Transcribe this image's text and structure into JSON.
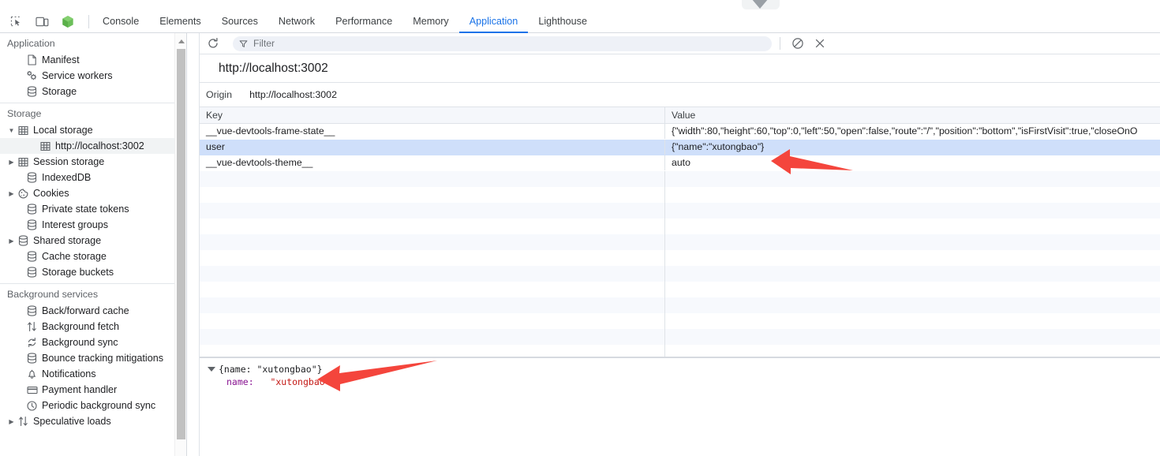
{
  "window": {
    "chevron_icon": "chevron-down-icon"
  },
  "toolbar": {
    "inspect_icon": "inspect-element-icon",
    "device_icon": "device-toolbar-icon",
    "vue_icon": "vue-logo-icon",
    "tabs": [
      {
        "label": "Console",
        "active": false
      },
      {
        "label": "Elements",
        "active": false
      },
      {
        "label": "Sources",
        "active": false
      },
      {
        "label": "Network",
        "active": false
      },
      {
        "label": "Performance",
        "active": false
      },
      {
        "label": "Memory",
        "active": false
      },
      {
        "label": "Application",
        "active": true
      },
      {
        "label": "Lighthouse",
        "active": false
      }
    ]
  },
  "sidebar": {
    "sections": [
      {
        "title": "Application",
        "items": [
          {
            "label": "Manifest",
            "icon": "manifest-file-icon",
            "indent": 2,
            "twisty": "",
            "selected": false
          },
          {
            "label": "Service workers",
            "icon": "service-workers-icon",
            "indent": 2,
            "twisty": "",
            "selected": false
          },
          {
            "label": "Storage",
            "icon": "database-icon",
            "indent": 2,
            "twisty": "",
            "selected": false
          }
        ]
      },
      {
        "title": "Storage",
        "items": [
          {
            "label": "Local storage",
            "icon": "table-grid-icon",
            "indent": 1,
            "twisty": "▼",
            "selected": false
          },
          {
            "label": "http://localhost:3002",
            "icon": "table-grid-icon",
            "indent": 3,
            "twisty": "",
            "selected": true
          },
          {
            "label": "Session storage",
            "icon": "table-grid-icon",
            "indent": 1,
            "twisty": "▶",
            "selected": false
          },
          {
            "label": "IndexedDB",
            "icon": "database-icon",
            "indent": 2,
            "twisty": "",
            "selected": false
          },
          {
            "label": "Cookies",
            "icon": "cookie-icon",
            "indent": 1,
            "twisty": "▶",
            "selected": false
          },
          {
            "label": "Private state tokens",
            "icon": "database-icon",
            "indent": 2,
            "twisty": "",
            "selected": false
          },
          {
            "label": "Interest groups",
            "icon": "database-icon",
            "indent": 2,
            "twisty": "",
            "selected": false
          },
          {
            "label": "Shared storage",
            "icon": "database-icon",
            "indent": 1,
            "twisty": "▶",
            "selected": false
          },
          {
            "label": "Cache storage",
            "icon": "database-icon",
            "indent": 2,
            "twisty": "",
            "selected": false
          },
          {
            "label": "Storage buckets",
            "icon": "database-icon",
            "indent": 2,
            "twisty": "",
            "selected": false
          }
        ]
      },
      {
        "title": "Background services",
        "items": [
          {
            "label": "Back/forward cache",
            "icon": "database-icon",
            "indent": 2,
            "twisty": "",
            "selected": false
          },
          {
            "label": "Background fetch",
            "icon": "updown-arrows-icon",
            "indent": 2,
            "twisty": "",
            "selected": false
          },
          {
            "label": "Background sync",
            "icon": "sync-icon",
            "indent": 2,
            "twisty": "",
            "selected": false
          },
          {
            "label": "Bounce tracking mitigations",
            "icon": "database-icon",
            "indent": 2,
            "twisty": "",
            "selected": false
          },
          {
            "label": "Notifications",
            "icon": "bell-icon",
            "indent": 2,
            "twisty": "",
            "selected": false
          },
          {
            "label": "Payment handler",
            "icon": "credit-card-icon",
            "indent": 2,
            "twisty": "",
            "selected": false
          },
          {
            "label": "Periodic background sync",
            "icon": "clock-icon",
            "indent": 2,
            "twisty": "",
            "selected": false
          },
          {
            "label": "Speculative loads",
            "icon": "updown-arrows-icon",
            "indent": 1,
            "twisty": "▶",
            "selected": false
          }
        ]
      }
    ]
  },
  "storage_toolbar": {
    "refresh_icon": "refresh-icon",
    "filter_icon": "filter-funnel-icon",
    "filter_placeholder": "Filter",
    "filter_value": "",
    "clear_icon": "clear-all-icon",
    "delete_icon": "delete-x-icon"
  },
  "panel": {
    "url_title": "http://localhost:3002",
    "origin_label": "Origin",
    "origin_value": "http://localhost:3002"
  },
  "table": {
    "columns": [
      "Key",
      "Value"
    ],
    "rows": [
      {
        "key": "__vue-devtools-frame-state__",
        "value": "{\"width\":80,\"height\":60,\"top\":0,\"left\":50,\"open\":false,\"route\":\"/\",\"position\":\"bottom\",\"isFirstVisit\":true,\"closeOnO",
        "selected": false
      },
      {
        "key": "user",
        "value": "{\"name\":\"xutongbao\"}",
        "selected": true
      },
      {
        "key": "__vue-devtools-theme__",
        "value": "auto",
        "selected": false
      }
    ]
  },
  "preview": {
    "summary": "{name: \"xutongbao\"}",
    "expand_icon": "triangle-down-icon",
    "property_key": "name:",
    "property_value": "\"xutongbao\""
  },
  "annotations": {
    "arrow_color": "#f4453c",
    "arrows": [
      {
        "name": "arrow-pointing-to-user-value"
      },
      {
        "name": "arrow-pointing-to-preview-property"
      }
    ]
  }
}
